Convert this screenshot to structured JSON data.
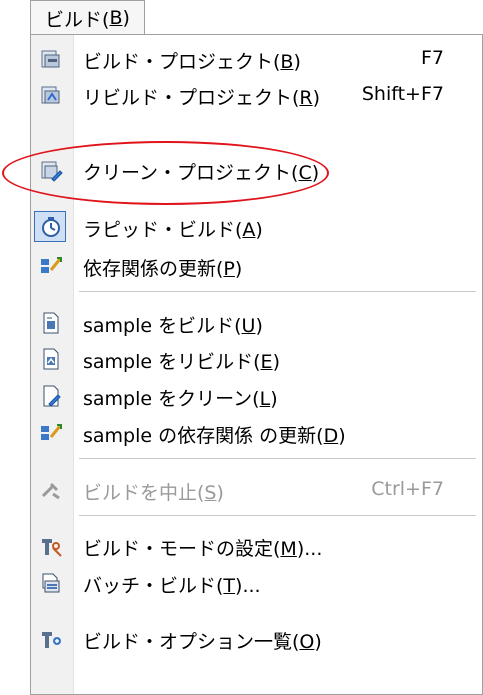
{
  "menubar": {
    "title_text": "ビルド(",
    "title_mnemonic": "B",
    "title_end": ")"
  },
  "items": [
    {
      "text": "ビルド・プロジェクト(",
      "mnemonic": "B",
      "end": ")",
      "shortcut": "F7",
      "icon": "build-icon"
    },
    {
      "text": "リビルド・プロジェクト(",
      "mnemonic": "R",
      "end": ")",
      "shortcut": "Shift+F7",
      "icon": "rebuild-icon"
    },
    {
      "text": "クリーン・プロジェクト(",
      "mnemonic": "C",
      "end": ")",
      "shortcut": "",
      "icon": "clean-icon"
    },
    {
      "text": "ラピッド・ビルド(",
      "mnemonic": "A",
      "end": ")",
      "shortcut": "",
      "icon": "rapid-build-icon"
    },
    {
      "text": "依存関係の更新(",
      "mnemonic": "P",
      "end": ")",
      "shortcut": "",
      "icon": "update-dependencies-icon"
    },
    {
      "text": "sample をビルド(",
      "mnemonic": "U",
      "end": ")",
      "shortcut": "",
      "icon": "file-build-icon"
    },
    {
      "text": "sample をリビルド(",
      "mnemonic": "E",
      "end": ")",
      "shortcut": "",
      "icon": "file-rebuild-icon"
    },
    {
      "text": "sample をクリーン(",
      "mnemonic": "L",
      "end": ")",
      "shortcut": "",
      "icon": "file-clean-icon"
    },
    {
      "text": "sample の依存関係 の更新(",
      "mnemonic": "D",
      "end": ")",
      "shortcut": "",
      "icon": "file-update-dependencies-icon"
    },
    {
      "text": "ビルドを中止(",
      "mnemonic": "S",
      "end": ")",
      "shortcut": "Ctrl+F7",
      "icon": "stop-build-icon"
    },
    {
      "text": "ビルド・モードの設定(",
      "mnemonic": "M",
      "end": ")...",
      "shortcut": "",
      "icon": "build-mode-icon"
    },
    {
      "text": "バッチ・ビルド(",
      "mnemonic": "T",
      "end": ")...",
      "shortcut": "",
      "icon": "batch-build-icon"
    },
    {
      "text": "ビルド・オプション一覧(",
      "mnemonic": "O",
      "end": ")",
      "shortcut": "",
      "icon": "build-options-list-icon"
    }
  ],
  "colors": {
    "highlight": "#e0141b",
    "checked_border": "#3b6fb6",
    "disabled_text": "#9a9a9a"
  }
}
